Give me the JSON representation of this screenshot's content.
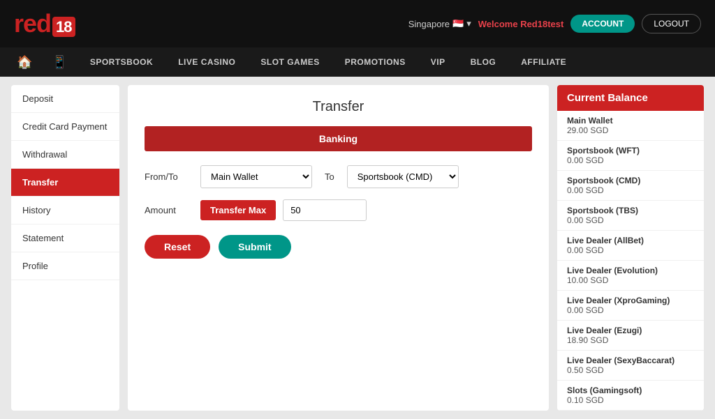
{
  "topbar": {
    "logo_red": "red",
    "logo_num": "18",
    "region": "Singapore",
    "welcome_text": "Welcome ",
    "username": "Red18test",
    "account_btn": "ACCOUNT",
    "logout_btn": "LOGOUT"
  },
  "nav": {
    "items": [
      {
        "label": "SPORTSBOOK"
      },
      {
        "label": "LIVE CASINO"
      },
      {
        "label": "SLOT GAMES"
      },
      {
        "label": "PROMOTIONS"
      },
      {
        "label": "VIP"
      },
      {
        "label": "BLOG"
      },
      {
        "label": "AFFILIATE"
      }
    ]
  },
  "sidebar": {
    "items": [
      {
        "label": "Deposit",
        "active": false
      },
      {
        "label": "Credit Card Payment",
        "active": false
      },
      {
        "label": "Withdrawal",
        "active": false
      },
      {
        "label": "Transfer",
        "active": true
      },
      {
        "label": "History",
        "active": false
      },
      {
        "label": "Statement",
        "active": false
      },
      {
        "label": "Profile",
        "active": false
      }
    ]
  },
  "content": {
    "title": "Transfer",
    "banking_header": "Banking",
    "from_to_label": "From/To",
    "from_value": "Main Wallet",
    "to_label": "To",
    "to_value": "Sportsbook (CMD)",
    "amount_label": "Amount",
    "transfer_max_btn": "Transfer Max",
    "amount_value": "50",
    "reset_btn": "Reset",
    "submit_btn": "Submit"
  },
  "balance": {
    "header": "Current Balance",
    "items": [
      {
        "label": "Main Wallet",
        "value": "29.00 SGD"
      },
      {
        "label": "Sportsbook (WFT)",
        "value": "0.00 SGD"
      },
      {
        "label": "Sportsbook (CMD)",
        "value": "0.00 SGD"
      },
      {
        "label": "Sportsbook (TBS)",
        "value": "0.00 SGD"
      },
      {
        "label": "Live Dealer (AllBet)",
        "value": "0.00 SGD"
      },
      {
        "label": "Live Dealer (Evolution)",
        "value": "10.00 SGD"
      },
      {
        "label": "Live Dealer (XproGaming)",
        "value": "0.00 SGD"
      },
      {
        "label": "Live Dealer (Ezugi)",
        "value": "18.90 SGD"
      },
      {
        "label": "Live Dealer (SexyBaccarat)",
        "value": "0.50 SGD"
      },
      {
        "label": "Slots (Gamingsoft)",
        "value": "0.10 SGD"
      }
    ]
  }
}
